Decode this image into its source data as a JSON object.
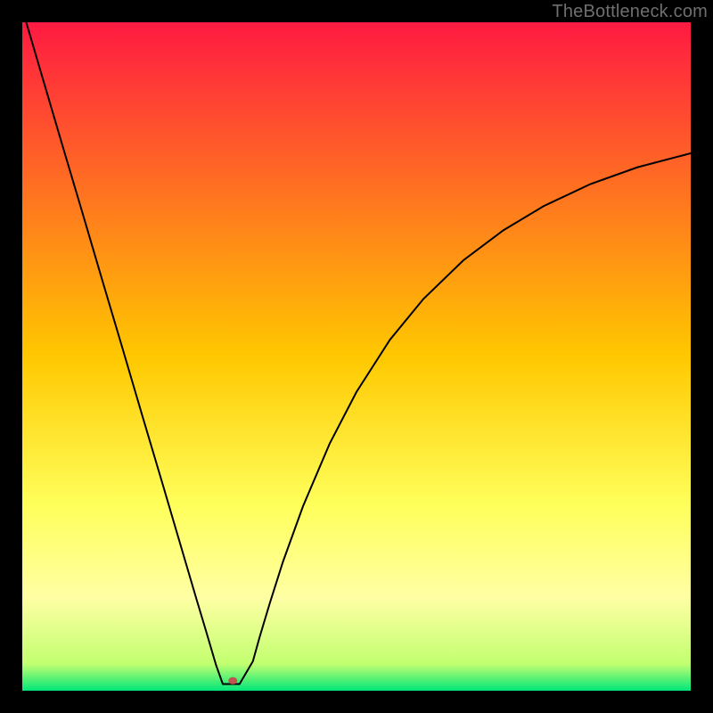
{
  "watermark": "TheBottleneck.com",
  "chart_data": {
    "type": "line",
    "title": "",
    "xlabel": "",
    "ylabel": "",
    "xlim": [
      0,
      100
    ],
    "ylim": [
      0,
      100
    ],
    "grid": false,
    "legend": false,
    "background_gradient": {
      "orientation": "vertical",
      "stops": [
        {
          "offset": 0.0,
          "color": "#ff1a42"
        },
        {
          "offset": 0.5,
          "color": "#ffc800"
        },
        {
          "offset": 0.72,
          "color": "#ffff5a"
        },
        {
          "offset": 0.86,
          "color": "#ffffa4"
        },
        {
          "offset": 0.96,
          "color": "#c2ff70"
        },
        {
          "offset": 1.0,
          "color": "#00e77a"
        }
      ]
    },
    "series": [
      {
        "name": "curve",
        "color": "#000000",
        "width": 2,
        "x": [
          0.0,
          3.0,
          6.0,
          9.0,
          12.0,
          15.0,
          18.0,
          21.0,
          24.0,
          26.0,
          27.5,
          29.0,
          30.0,
          31.0,
          32.5,
          34.5,
          35.5,
          37.0,
          39.0,
          42.0,
          46.0,
          50.0,
          55.0,
          60.0,
          66.0,
          72.0,
          78.0,
          85.0,
          92.0,
          100.0
        ],
        "y": [
          102.0,
          91.8,
          81.6,
          71.5,
          61.3,
          51.2,
          41.0,
          30.9,
          20.7,
          13.9,
          8.9,
          3.8,
          1.0,
          1.0,
          1.0,
          4.4,
          8.0,
          13.0,
          19.3,
          27.6,
          37.0,
          44.7,
          52.5,
          58.6,
          64.4,
          68.9,
          72.5,
          75.8,
          78.3,
          80.4
        ]
      }
    ],
    "marker": {
      "name": "min-point",
      "x": 31.5,
      "y": 1.5,
      "rx": 5,
      "ry": 4,
      "color": "#c1544f"
    }
  }
}
